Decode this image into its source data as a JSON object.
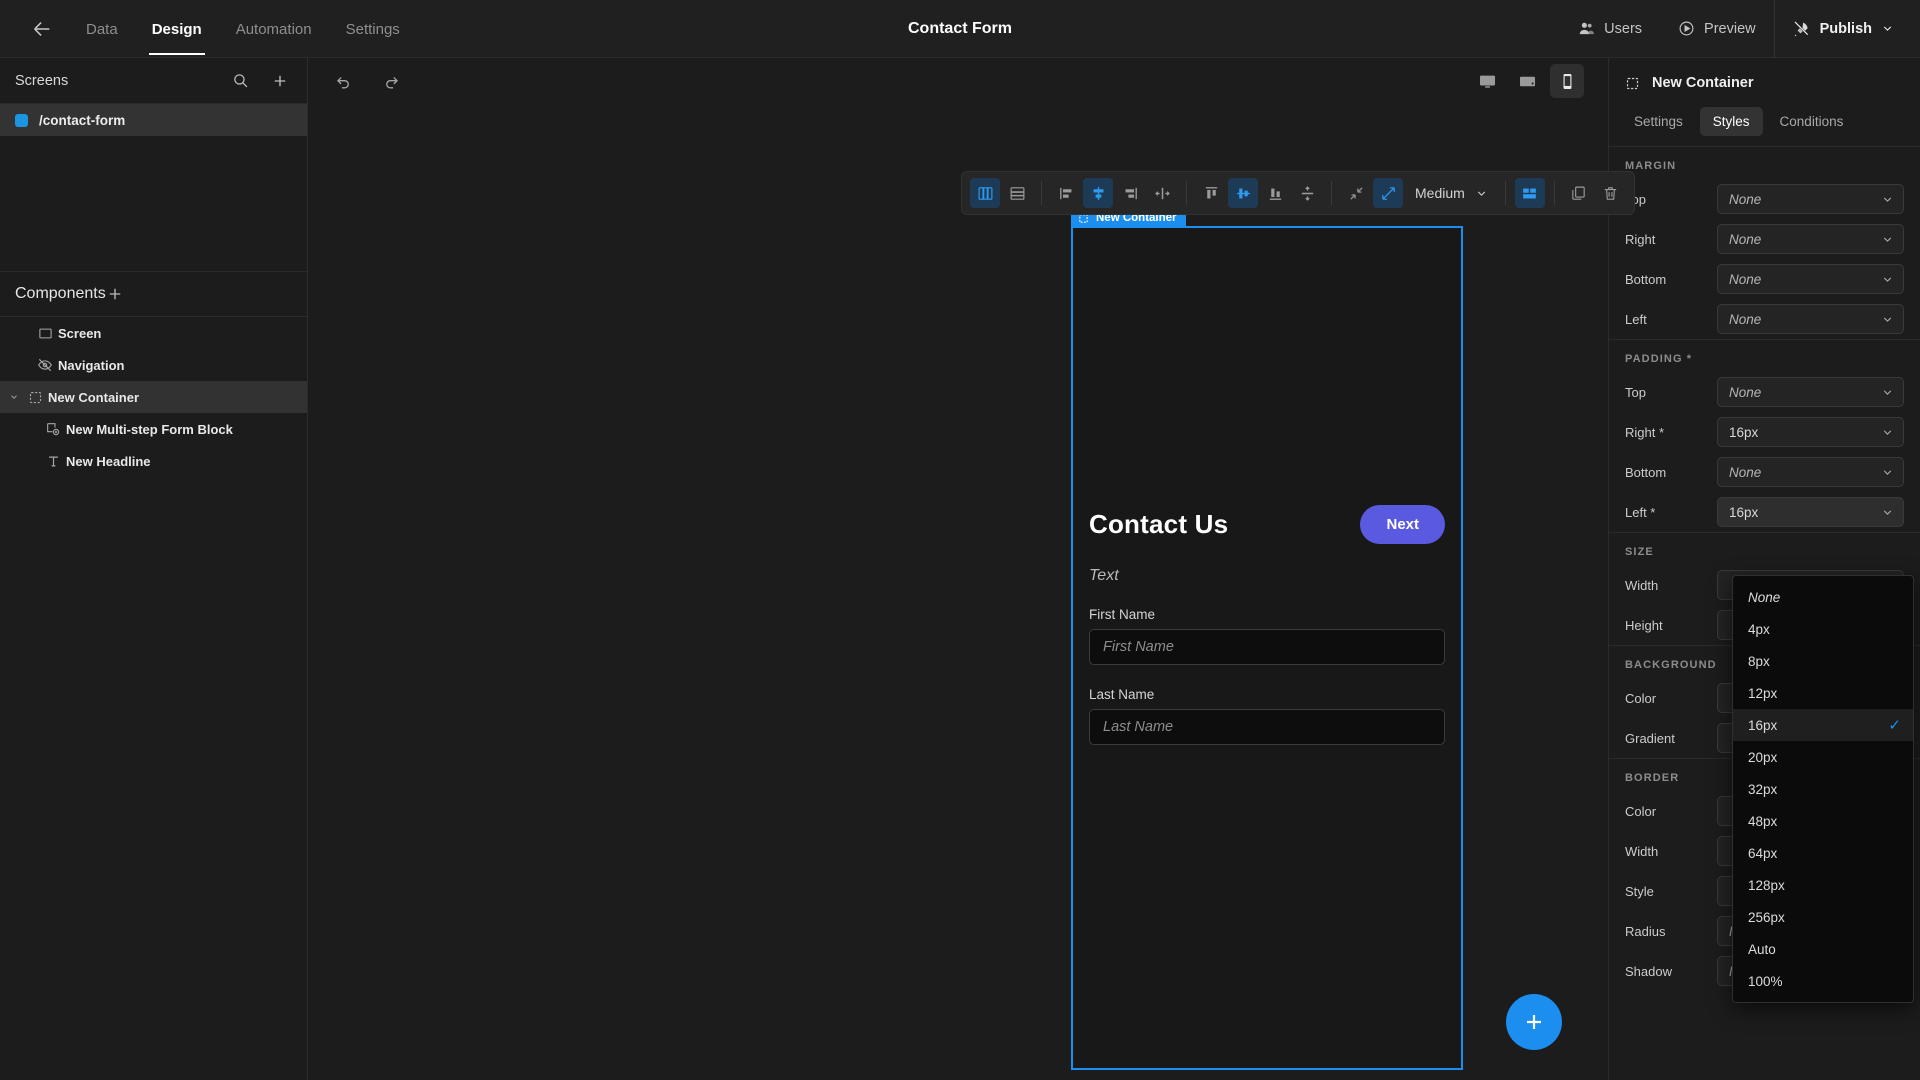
{
  "topbar": {
    "back_icon": "arrow-left-icon",
    "nav": [
      {
        "label": "Data",
        "active": false
      },
      {
        "label": "Design",
        "active": true
      },
      {
        "label": "Automation",
        "active": false
      },
      {
        "label": "Settings",
        "active": false
      }
    ],
    "title": "Contact Form",
    "users_label": "Users",
    "preview_label": "Preview",
    "publish_label": "Publish"
  },
  "left_panel": {
    "screens_title": "Screens",
    "search_icon": "search-icon",
    "add_icon": "plus-icon",
    "screens": [
      {
        "label": "/contact-form",
        "selected": true
      }
    ],
    "components_title": "Components",
    "components_add_icon": "plus-icon",
    "tree": [
      {
        "label": "Screen",
        "icon": "screen-icon",
        "depth": 0,
        "selected": false,
        "caret": false
      },
      {
        "label": "Navigation",
        "icon": "navigation-hidden-icon",
        "depth": 0,
        "selected": false,
        "caret": false
      },
      {
        "label": "New Container",
        "icon": "container-icon",
        "depth": 0,
        "selected": true,
        "caret": true
      },
      {
        "label": "New Multi-step Form Block",
        "icon": "form-block-icon",
        "depth": 1,
        "selected": false,
        "caret": false
      },
      {
        "label": "New Headline",
        "icon": "text-icon",
        "depth": 1,
        "selected": false,
        "caret": false
      }
    ]
  },
  "canvas": {
    "undo_icon": "undo-icon",
    "redo_icon": "redo-icon",
    "devices": [
      {
        "name": "desktop",
        "active": false
      },
      {
        "name": "tablet",
        "active": false
      },
      {
        "name": "mobile",
        "active": true
      }
    ],
    "toolbar": {
      "buttons": [
        {
          "name": "layout-columns",
          "active": true
        },
        {
          "name": "layout-rows",
          "active": false
        },
        {
          "name": "align-left",
          "active": false
        },
        {
          "name": "align-center-horizontal",
          "active": true
        },
        {
          "name": "align-right",
          "active": false
        },
        {
          "name": "distribute-horizontal",
          "active": false
        },
        {
          "name": "align-top",
          "active": false
        },
        {
          "name": "align-middle-vertical",
          "active": true
        },
        {
          "name": "align-bottom",
          "active": false
        },
        {
          "name": "distribute-vertical",
          "active": false
        },
        {
          "name": "collapse",
          "active": false
        },
        {
          "name": "expand",
          "active": true
        }
      ],
      "gap_value": "Medium",
      "grid_icon": "grid-icon",
      "duplicate_icon": "duplicate-icon",
      "delete_icon": "trash-icon"
    },
    "container_tag": "New Container",
    "form": {
      "title": "Contact Us",
      "next_label": "Next",
      "text_placeholder": "Text",
      "fields": [
        {
          "label": "First Name",
          "placeholder": "First Name",
          "value": ""
        },
        {
          "label": "Last Name",
          "placeholder": "Last Name",
          "value": ""
        }
      ]
    },
    "fab_icon": "plus-icon"
  },
  "right_panel": {
    "selection_title": "New Container",
    "selection_icon": "container-icon",
    "tabs": [
      {
        "label": "Settings",
        "active": false
      },
      {
        "label": "Styles",
        "active": true
      },
      {
        "label": "Conditions",
        "active": false
      }
    ],
    "sections": [
      {
        "title": "MARGIN",
        "rows": [
          {
            "label": "Top",
            "value": "None",
            "is_none": true
          },
          {
            "label": "Right",
            "value": "None",
            "is_none": true
          },
          {
            "label": "Bottom",
            "value": "None",
            "is_none": true
          },
          {
            "label": "Left",
            "value": "None",
            "is_none": true
          }
        ]
      },
      {
        "title": "PADDING *",
        "rows": [
          {
            "label": "Top",
            "value": "None",
            "is_none": true
          },
          {
            "label": "Right *",
            "value": "16px",
            "is_none": false
          },
          {
            "label": "Bottom",
            "value": "None",
            "is_none": true
          },
          {
            "label": "Left *",
            "value": "16px",
            "is_none": false,
            "open": true
          }
        ]
      },
      {
        "title": "SIZE",
        "rows": [
          {
            "label": "Width",
            "value": "",
            "is_none": true
          },
          {
            "label": "Height",
            "value": "",
            "is_none": true
          }
        ]
      },
      {
        "title": "BACKGROUND",
        "rows": [
          {
            "label": "Color",
            "value": "",
            "is_none": true
          },
          {
            "label": "Gradient",
            "value": "",
            "is_none": true
          }
        ]
      },
      {
        "title": "BORDER",
        "rows": [
          {
            "label": "Color",
            "value": "",
            "is_none": true
          },
          {
            "label": "Width",
            "value": "",
            "is_none": true
          },
          {
            "label": "Style",
            "value": "",
            "is_none": true
          },
          {
            "label": "Radius",
            "value": "None",
            "is_none": true
          },
          {
            "label": "Shadow",
            "value": "None",
            "is_none": true
          }
        ]
      }
    ]
  },
  "dropdown": {
    "options": [
      {
        "label": "None",
        "italic": true,
        "selected": false
      },
      {
        "label": "4px",
        "italic": false,
        "selected": false
      },
      {
        "label": "8px",
        "italic": false,
        "selected": false
      },
      {
        "label": "12px",
        "italic": false,
        "selected": false
      },
      {
        "label": "16px",
        "italic": false,
        "selected": true
      },
      {
        "label": "20px",
        "italic": false,
        "selected": false
      },
      {
        "label": "32px",
        "italic": false,
        "selected": false
      },
      {
        "label": "48px",
        "italic": false,
        "selected": false
      },
      {
        "label": "64px",
        "italic": false,
        "selected": false
      },
      {
        "label": "128px",
        "italic": false,
        "selected": false
      },
      {
        "label": "256px",
        "italic": false,
        "selected": false
      },
      {
        "label": "Auto",
        "italic": false,
        "selected": false
      },
      {
        "label": "100%",
        "italic": false,
        "selected": false
      }
    ],
    "check_glyph": "✓"
  },
  "colors": {
    "accent_blue": "#1b8ef0",
    "button_purple": "#5a5ae0",
    "bg": "#1c1c1c",
    "panel": "#202020"
  }
}
